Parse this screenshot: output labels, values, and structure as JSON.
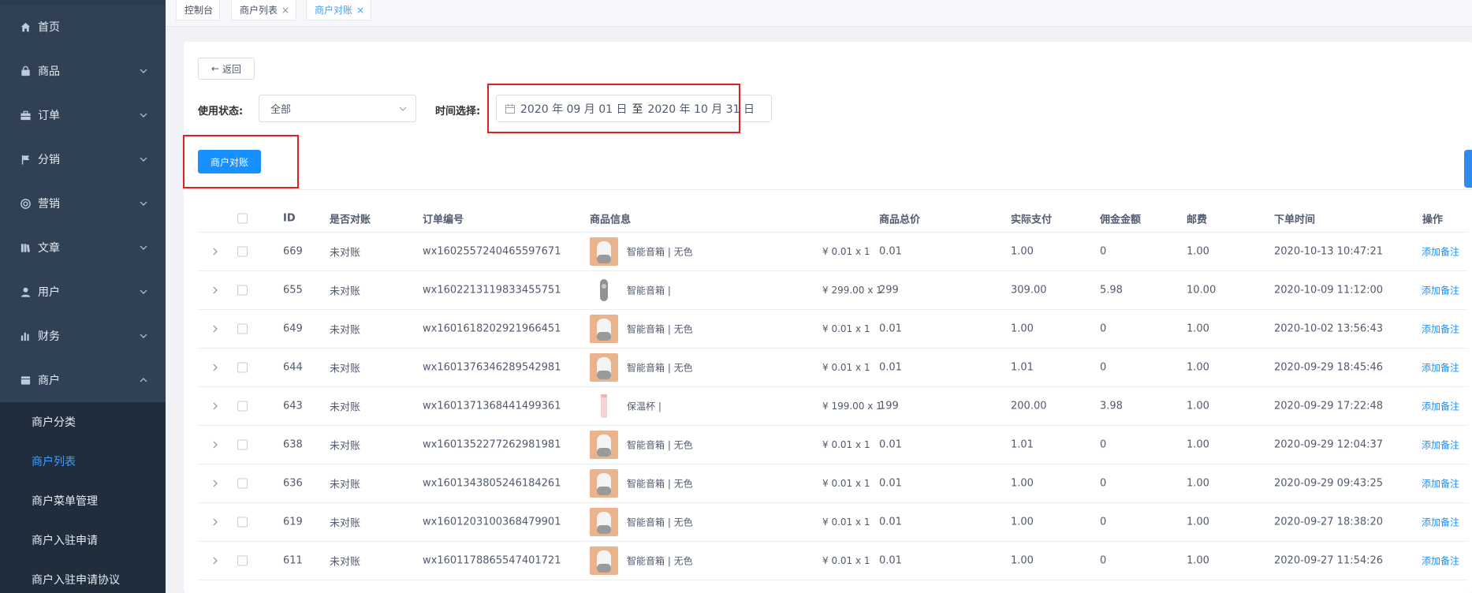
{
  "sidebar": {
    "menu": [
      {
        "label": "首页",
        "icon": "home-icon",
        "expandable": false
      },
      {
        "label": "商品",
        "icon": "bag-icon",
        "expandable": true
      },
      {
        "label": "订单",
        "icon": "briefcase-icon",
        "expandable": true
      },
      {
        "label": "分销",
        "icon": "flag-icon",
        "expandable": true
      },
      {
        "label": "营销",
        "icon": "lifebuoy-icon",
        "expandable": true
      },
      {
        "label": "文章",
        "icon": "book-icon",
        "expandable": true
      },
      {
        "label": "用户",
        "icon": "user-icon",
        "expandable": true
      },
      {
        "label": "财务",
        "icon": "bar-chart-icon",
        "expandable": true
      },
      {
        "label": "商户",
        "icon": "store-icon",
        "expandable": true,
        "expanded": true
      }
    ],
    "submenu": [
      {
        "label": "商户分类",
        "active": false
      },
      {
        "label": "商户列表",
        "active": true
      },
      {
        "label": "商户菜单管理",
        "active": false
      },
      {
        "label": "商户入驻申请",
        "active": false
      },
      {
        "label": "商户入驻申请协议",
        "active": false
      }
    ]
  },
  "tags": [
    {
      "label": "控制台",
      "closable": false,
      "active": false
    },
    {
      "label": "商户列表",
      "closable": true,
      "active": false
    },
    {
      "label": "商户对账",
      "closable": true,
      "active": true
    }
  ],
  "toolbar": {
    "back_label": "返回",
    "status_label": "使用状态:",
    "status_value": "全部",
    "time_label": "时间选择:",
    "date_start": "2020 年 09 月 01 日",
    "date_sep": "至",
    "date_end": "2020 年 10 月 31 日",
    "reconcile_button": "商户对账"
  },
  "colors": {
    "sidebar_bg": "#304156",
    "submenu_bg": "#1f2d3d",
    "accent": "#1890ff",
    "highlight": "#e02020"
  },
  "table": {
    "headers": [
      "ID",
      "是否对账",
      "订单编号",
      "商品信息",
      "商品总价",
      "实际支付",
      "佣金金额",
      "邮费",
      "下单时间",
      "操作"
    ],
    "action_label": "添加备注",
    "rows": [
      {
        "id": "669",
        "status": "未对账",
        "order_no": "wx1602557240465597671",
        "product": "智能音箱 | 无色",
        "price_qty": "¥ 0.01 x 1",
        "total": "0.01",
        "paid": "1.00",
        "commission": "0",
        "postage": "1.00",
        "time": "2020-10-13 10:47:21",
        "thumb": "speaker"
      },
      {
        "id": "655",
        "status": "未对账",
        "order_no": "wx1602213119833455751",
        "product": "智能音箱 |",
        "price_qty": "¥ 299.00 x 1",
        "total": "299",
        "paid": "309.00",
        "commission": "5.98",
        "postage": "10.00",
        "time": "2020-10-09 11:12:00",
        "thumb": "speaker-gray"
      },
      {
        "id": "649",
        "status": "未对账",
        "order_no": "wx1601618202921966451",
        "product": "智能音箱 | 无色",
        "price_qty": "¥ 0.01 x 1",
        "total": "0.01",
        "paid": "1.00",
        "commission": "0",
        "postage": "1.00",
        "time": "2020-10-02 13:56:43",
        "thumb": "speaker"
      },
      {
        "id": "644",
        "status": "未对账",
        "order_no": "wx1601376346289542981",
        "product": "智能音箱 | 无色",
        "price_qty": "¥ 0.01 x 1",
        "total": "0.01",
        "paid": "1.01",
        "commission": "0",
        "postage": "1.00",
        "time": "2020-09-29 18:45:46",
        "thumb": "speaker"
      },
      {
        "id": "643",
        "status": "未对账",
        "order_no": "wx1601371368441499361",
        "product": "保温杯 |",
        "price_qty": "¥ 199.00 x 1",
        "total": "199",
        "paid": "200.00",
        "commission": "3.98",
        "postage": "1.00",
        "time": "2020-09-29 17:22:48",
        "thumb": "cup"
      },
      {
        "id": "638",
        "status": "未对账",
        "order_no": "wx1601352277262981981",
        "product": "智能音箱 | 无色",
        "price_qty": "¥ 0.01 x 1",
        "total": "0.01",
        "paid": "1.01",
        "commission": "0",
        "postage": "1.00",
        "time": "2020-09-29 12:04:37",
        "thumb": "speaker"
      },
      {
        "id": "636",
        "status": "未对账",
        "order_no": "wx1601343805246184261",
        "product": "智能音箱 | 无色",
        "price_qty": "¥ 0.01 x 1",
        "total": "0.01",
        "paid": "1.00",
        "commission": "0",
        "postage": "1.00",
        "time": "2020-09-29 09:43:25",
        "thumb": "speaker"
      },
      {
        "id": "619",
        "status": "未对账",
        "order_no": "wx1601203100368479901",
        "product": "智能音箱 | 无色",
        "price_qty": "¥ 0.01 x 1",
        "total": "0.01",
        "paid": "1.00",
        "commission": "0",
        "postage": "1.00",
        "time": "2020-09-27 18:38:20",
        "thumb": "speaker"
      },
      {
        "id": "611",
        "status": "未对账",
        "order_no": "wx1601178865547401721",
        "product": "智能音箱 | 无色",
        "price_qty": "¥ 0.01 x 1",
        "total": "0.01",
        "paid": "1.00",
        "commission": "0",
        "postage": "1.00",
        "time": "2020-09-27 11:54:26",
        "thumb": "speaker"
      }
    ]
  }
}
